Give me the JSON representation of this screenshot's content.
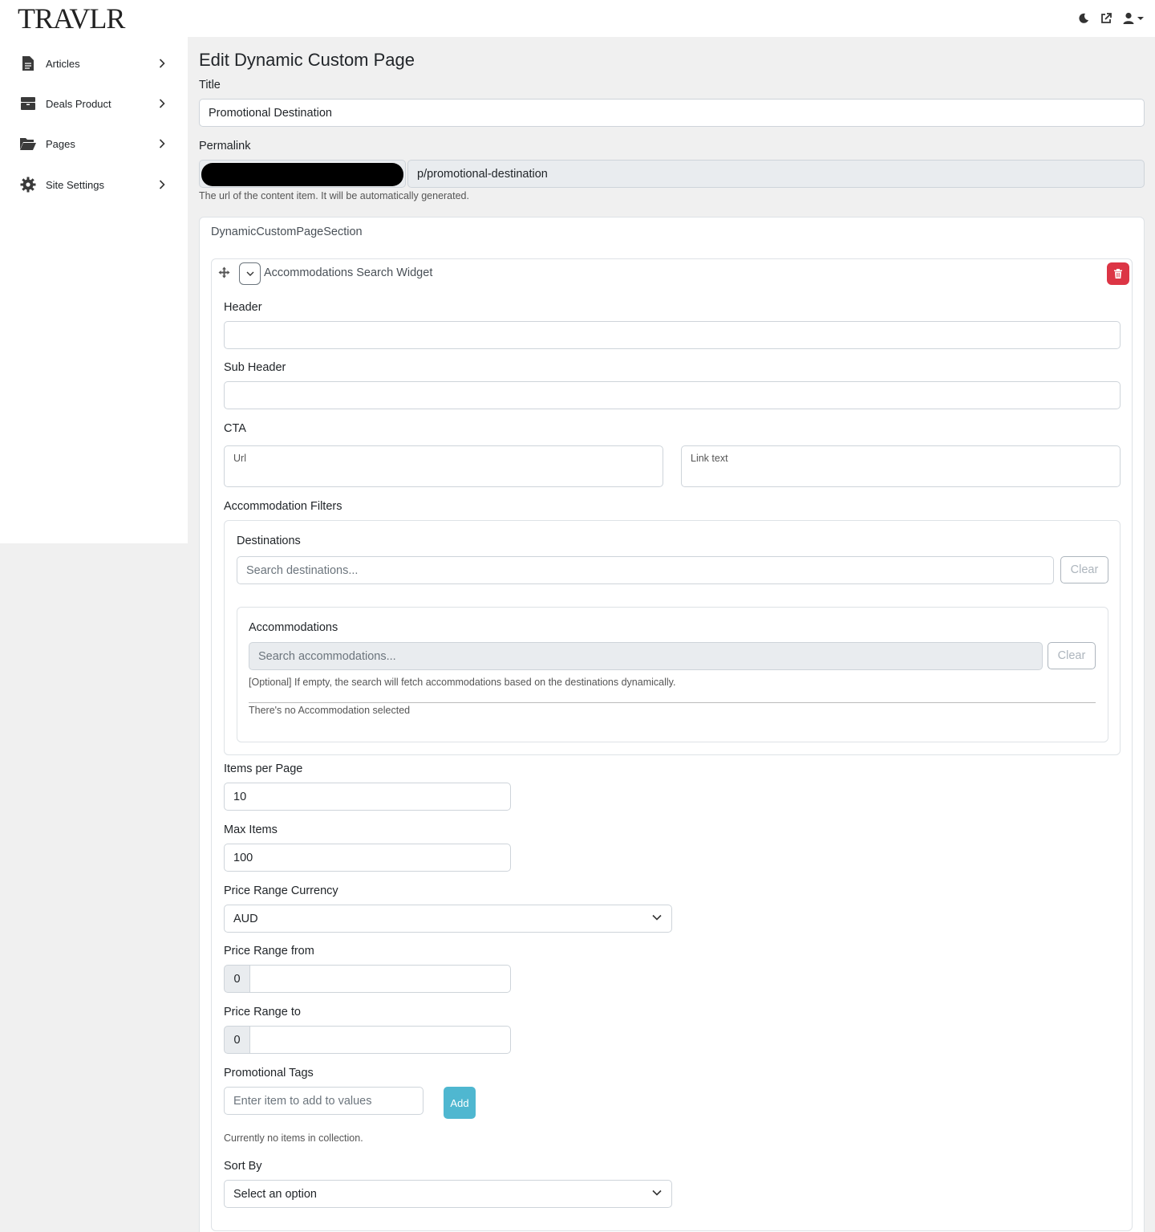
{
  "app": {
    "logo": "TRAVLR"
  },
  "topbar": {
    "icons": [
      "moon-icon",
      "external-link-icon",
      "user-icon",
      "caret-down-icon"
    ]
  },
  "sidebar": {
    "items": [
      {
        "label": "Articles",
        "icon": "file-icon"
      },
      {
        "label": "Deals Product",
        "icon": "box-icon"
      },
      {
        "label": "Pages",
        "icon": "folder-open-icon"
      },
      {
        "label": "Site Settings",
        "icon": "gear-icon"
      }
    ]
  },
  "page": {
    "title": "Edit Dynamic Custom Page",
    "title_label": "Title",
    "title_value": "Promotional Destination",
    "permalink_label": "Permalink",
    "permalink_value": "p/promotional-destination",
    "permalink_help": "The url of the content item. It will be automatically generated."
  },
  "section": {
    "title": "DynamicCustomPageSection",
    "widget": {
      "title": "Accommodations Search Widget",
      "header_label": "Header",
      "header_value": "",
      "subheader_label": "Sub Header",
      "subheader_value": "",
      "cta_label": "CTA",
      "cta_url_label": "Url",
      "cta_link_text_label": "Link text",
      "filters_label": "Accommodation Filters",
      "destinations": {
        "label": "Destinations",
        "placeholder": "Search destinations...",
        "clear_label": "Clear"
      },
      "accommodations": {
        "label": "Accommodations",
        "placeholder": "Search accommodations...",
        "clear_label": "Clear",
        "help": "[Optional] If empty, the search will fetch accommodations based on the destinations dynamically.",
        "empty_text": "There's no Accommodation selected"
      },
      "items_per_page_label": "Items per Page",
      "items_per_page_value": "10",
      "max_items_label": "Max Items",
      "max_items_value": "100",
      "currency_label": "Price Range Currency",
      "currency_value": "AUD",
      "price_from_label": "Price Range from",
      "price_from_value": "0",
      "price_to_label": "Price Range to",
      "price_to_value": "0",
      "tags_label": "Promotional Tags",
      "tags_placeholder": "Enter item to add to values",
      "tags_add_label": "Add",
      "tags_empty": "Currently no items in collection.",
      "sort_label": "Sort By",
      "sort_value": "Select an option"
    }
  },
  "colors": {
    "delete": "#dc3545",
    "add": "#4fb7d0"
  }
}
